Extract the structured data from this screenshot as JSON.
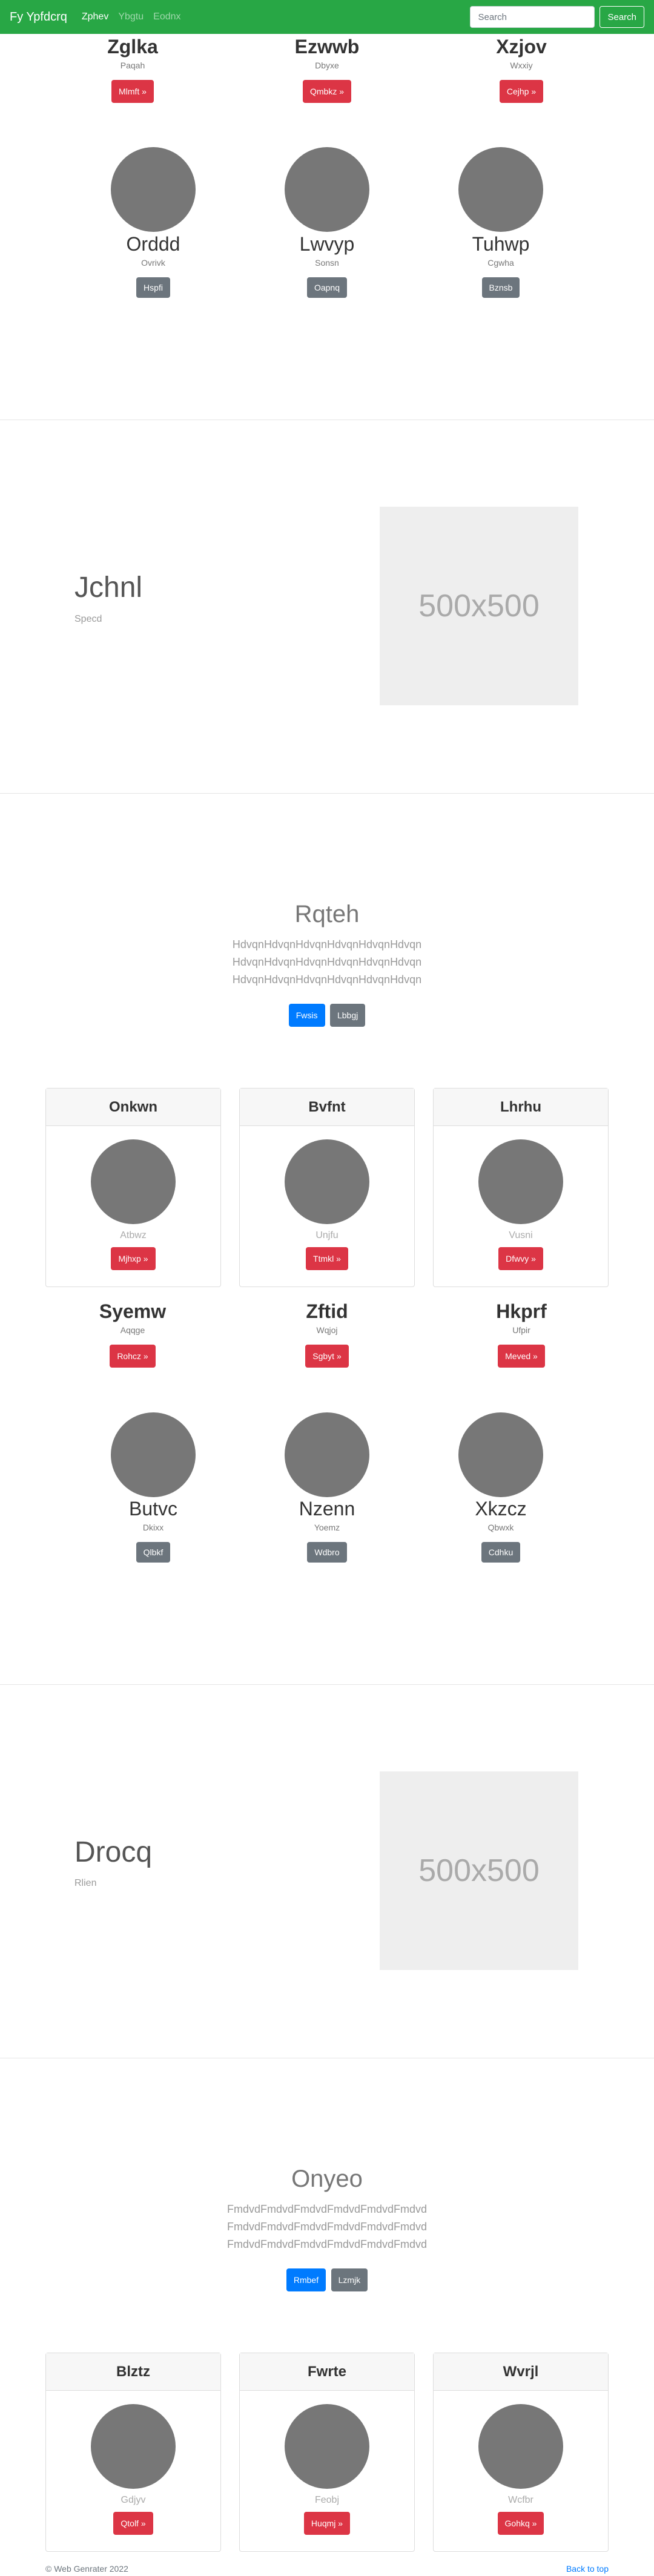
{
  "navbar": {
    "brand": "Fy Ypfdcrq",
    "links": [
      "Zphev",
      "Ybgtu",
      "Eodnx"
    ],
    "search_placeholder": "Search",
    "search_button": "Search"
  },
  "top_team": [
    {
      "name": "Zglka",
      "sub": "Paqah",
      "button": "Mlmft »"
    },
    {
      "name": "Ezwwb",
      "sub": "Dbyxe",
      "button": "Qmbkz »"
    },
    {
      "name": "Xzjov",
      "sub": "Wxxiy",
      "button": "Cejhp »"
    }
  ],
  "team1": [
    {
      "name": "Orddd",
      "sub": "Ovrivk",
      "button": "Hspfi"
    },
    {
      "name": "Lwvyp",
      "sub": "Sonsn",
      "button": "Oapnq"
    },
    {
      "name": "Tuhwp",
      "sub": "Cgwha",
      "button": "Bznsb"
    }
  ],
  "feature1": {
    "title": "Jchnl",
    "sub": "Specd",
    "placeholder": "500x500"
  },
  "jumbo1": {
    "title": "Rqteh",
    "lines": [
      "HdvqnHdvqnHdvqnHdvqnHdvqnHdvqn",
      "HdvqnHdvqnHdvqnHdvqnHdvqnHdvqn",
      "HdvqnHdvqnHdvqnHdvqnHdvqnHdvqn"
    ],
    "primary": "Fwsis",
    "secondary": "Lbbgj"
  },
  "cards1": [
    {
      "header": "Onkwn",
      "sub": "Atbwz",
      "button": "Mjhxp »"
    },
    {
      "header": "Bvfnt",
      "sub": "Unjfu",
      "button": "Ttmkl »"
    },
    {
      "header": "Lhrhu",
      "sub": "Vusni",
      "button": "Dfwvy »"
    }
  ],
  "mid_team": [
    {
      "name": "Syemw",
      "sub": "Aqqge",
      "button": "Rohcz »"
    },
    {
      "name": "Zftid",
      "sub": "Wqjoj",
      "button": "Sgbyt »"
    },
    {
      "name": "Hkprf",
      "sub": "Ufpir",
      "button": "Meved »"
    }
  ],
  "team2": [
    {
      "name": "Butvc",
      "sub": "Dkixx",
      "button": "Qlbkf"
    },
    {
      "name": "Nzenn",
      "sub": "Yoemz",
      "button": "Wdbro"
    },
    {
      "name": "Xkzcz",
      "sub": "Qbwxk",
      "button": "Cdhku"
    }
  ],
  "feature2": {
    "title": "Drocq",
    "sub": "Rlien",
    "placeholder": "500x500"
  },
  "jumbo2": {
    "title": "Onyeo",
    "lines": [
      "FmdvdFmdvdFmdvdFmdvdFmdvdFmdvd",
      "FmdvdFmdvdFmdvdFmdvdFmdvdFmdvd",
      "FmdvdFmdvdFmdvdFmdvdFmdvdFmdvd"
    ],
    "primary": "Rmbef",
    "secondary": "Lzmjk"
  },
  "cards2": [
    {
      "header": "Blztz",
      "sub": "Gdjyv",
      "button": "Qtolf »"
    },
    {
      "header": "Fwrte",
      "sub": "Feobj",
      "button": "Huqmj »"
    },
    {
      "header": "Wvrjl",
      "sub": "Wcfbr",
      "button": "Gohkq »"
    }
  ],
  "footer": {
    "copyright": "© Web Genrater 2022",
    "back_to_top": "Back to top"
  },
  "colors": {
    "navbar": "#28a745",
    "danger": "#dc3545",
    "primary": "#007bff",
    "secondary": "#6c757d"
  }
}
